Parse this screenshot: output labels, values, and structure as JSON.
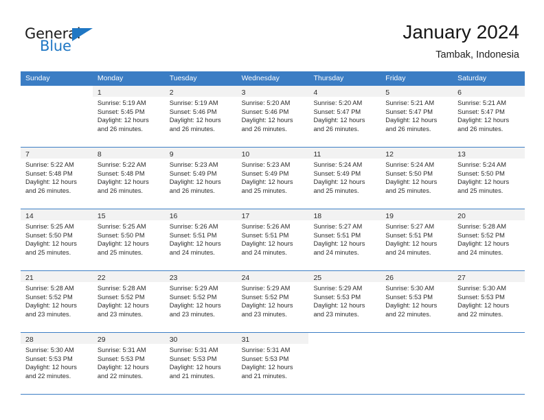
{
  "brand": {
    "name_top": "General",
    "name_bottom": "Blue",
    "accent_color": "#1f77c4"
  },
  "header": {
    "title": "January 2024",
    "subtitle": "Tambak, Indonesia"
  },
  "theme": {
    "header_band": "#3b7dc4",
    "daynum_band": "#f2f2f2",
    "rule": "#3b7dc4"
  },
  "weekdays": [
    "Sunday",
    "Monday",
    "Tuesday",
    "Wednesday",
    "Thursday",
    "Friday",
    "Saturday"
  ],
  "weeks": [
    {
      "lead_blanks": 1,
      "days": [
        {
          "num": "1",
          "sunrise": "Sunrise: 5:19 AM",
          "sunset": "Sunset: 5:45 PM",
          "daylight1": "Daylight: 12 hours",
          "daylight2": "and 26 minutes."
        },
        {
          "num": "2",
          "sunrise": "Sunrise: 5:19 AM",
          "sunset": "Sunset: 5:46 PM",
          "daylight1": "Daylight: 12 hours",
          "daylight2": "and 26 minutes."
        },
        {
          "num": "3",
          "sunrise": "Sunrise: 5:20 AM",
          "sunset": "Sunset: 5:46 PM",
          "daylight1": "Daylight: 12 hours",
          "daylight2": "and 26 minutes."
        },
        {
          "num": "4",
          "sunrise": "Sunrise: 5:20 AM",
          "sunset": "Sunset: 5:47 PM",
          "daylight1": "Daylight: 12 hours",
          "daylight2": "and 26 minutes."
        },
        {
          "num": "5",
          "sunrise": "Sunrise: 5:21 AM",
          "sunset": "Sunset: 5:47 PM",
          "daylight1": "Daylight: 12 hours",
          "daylight2": "and 26 minutes."
        },
        {
          "num": "6",
          "sunrise": "Sunrise: 5:21 AM",
          "sunset": "Sunset: 5:47 PM",
          "daylight1": "Daylight: 12 hours",
          "daylight2": "and 26 minutes."
        }
      ]
    },
    {
      "lead_blanks": 0,
      "days": [
        {
          "num": "7",
          "sunrise": "Sunrise: 5:22 AM",
          "sunset": "Sunset: 5:48 PM",
          "daylight1": "Daylight: 12 hours",
          "daylight2": "and 26 minutes."
        },
        {
          "num": "8",
          "sunrise": "Sunrise: 5:22 AM",
          "sunset": "Sunset: 5:48 PM",
          "daylight1": "Daylight: 12 hours",
          "daylight2": "and 26 minutes."
        },
        {
          "num": "9",
          "sunrise": "Sunrise: 5:23 AM",
          "sunset": "Sunset: 5:49 PM",
          "daylight1": "Daylight: 12 hours",
          "daylight2": "and 26 minutes."
        },
        {
          "num": "10",
          "sunrise": "Sunrise: 5:23 AM",
          "sunset": "Sunset: 5:49 PM",
          "daylight1": "Daylight: 12 hours",
          "daylight2": "and 25 minutes."
        },
        {
          "num": "11",
          "sunrise": "Sunrise: 5:24 AM",
          "sunset": "Sunset: 5:49 PM",
          "daylight1": "Daylight: 12 hours",
          "daylight2": "and 25 minutes."
        },
        {
          "num": "12",
          "sunrise": "Sunrise: 5:24 AM",
          "sunset": "Sunset: 5:50 PM",
          "daylight1": "Daylight: 12 hours",
          "daylight2": "and 25 minutes."
        },
        {
          "num": "13",
          "sunrise": "Sunrise: 5:24 AM",
          "sunset": "Sunset: 5:50 PM",
          "daylight1": "Daylight: 12 hours",
          "daylight2": "and 25 minutes."
        }
      ]
    },
    {
      "lead_blanks": 0,
      "days": [
        {
          "num": "14",
          "sunrise": "Sunrise: 5:25 AM",
          "sunset": "Sunset: 5:50 PM",
          "daylight1": "Daylight: 12 hours",
          "daylight2": "and 25 minutes."
        },
        {
          "num": "15",
          "sunrise": "Sunrise: 5:25 AM",
          "sunset": "Sunset: 5:50 PM",
          "daylight1": "Daylight: 12 hours",
          "daylight2": "and 25 minutes."
        },
        {
          "num": "16",
          "sunrise": "Sunrise: 5:26 AM",
          "sunset": "Sunset: 5:51 PM",
          "daylight1": "Daylight: 12 hours",
          "daylight2": "and 24 minutes."
        },
        {
          "num": "17",
          "sunrise": "Sunrise: 5:26 AM",
          "sunset": "Sunset: 5:51 PM",
          "daylight1": "Daylight: 12 hours",
          "daylight2": "and 24 minutes."
        },
        {
          "num": "18",
          "sunrise": "Sunrise: 5:27 AM",
          "sunset": "Sunset: 5:51 PM",
          "daylight1": "Daylight: 12 hours",
          "daylight2": "and 24 minutes."
        },
        {
          "num": "19",
          "sunrise": "Sunrise: 5:27 AM",
          "sunset": "Sunset: 5:51 PM",
          "daylight1": "Daylight: 12 hours",
          "daylight2": "and 24 minutes."
        },
        {
          "num": "20",
          "sunrise": "Sunrise: 5:28 AM",
          "sunset": "Sunset: 5:52 PM",
          "daylight1": "Daylight: 12 hours",
          "daylight2": "and 24 minutes."
        }
      ]
    },
    {
      "lead_blanks": 0,
      "days": [
        {
          "num": "21",
          "sunrise": "Sunrise: 5:28 AM",
          "sunset": "Sunset: 5:52 PM",
          "daylight1": "Daylight: 12 hours",
          "daylight2": "and 23 minutes."
        },
        {
          "num": "22",
          "sunrise": "Sunrise: 5:28 AM",
          "sunset": "Sunset: 5:52 PM",
          "daylight1": "Daylight: 12 hours",
          "daylight2": "and 23 minutes."
        },
        {
          "num": "23",
          "sunrise": "Sunrise: 5:29 AM",
          "sunset": "Sunset: 5:52 PM",
          "daylight1": "Daylight: 12 hours",
          "daylight2": "and 23 minutes."
        },
        {
          "num": "24",
          "sunrise": "Sunrise: 5:29 AM",
          "sunset": "Sunset: 5:52 PM",
          "daylight1": "Daylight: 12 hours",
          "daylight2": "and 23 minutes."
        },
        {
          "num": "25",
          "sunrise": "Sunrise: 5:29 AM",
          "sunset": "Sunset: 5:53 PM",
          "daylight1": "Daylight: 12 hours",
          "daylight2": "and 23 minutes."
        },
        {
          "num": "26",
          "sunrise": "Sunrise: 5:30 AM",
          "sunset": "Sunset: 5:53 PM",
          "daylight1": "Daylight: 12 hours",
          "daylight2": "and 22 minutes."
        },
        {
          "num": "27",
          "sunrise": "Sunrise: 5:30 AM",
          "sunset": "Sunset: 5:53 PM",
          "daylight1": "Daylight: 12 hours",
          "daylight2": "and 22 minutes."
        }
      ]
    },
    {
      "lead_blanks": 0,
      "days": [
        {
          "num": "28",
          "sunrise": "Sunrise: 5:30 AM",
          "sunset": "Sunset: 5:53 PM",
          "daylight1": "Daylight: 12 hours",
          "daylight2": "and 22 minutes."
        },
        {
          "num": "29",
          "sunrise": "Sunrise: 5:31 AM",
          "sunset": "Sunset: 5:53 PM",
          "daylight1": "Daylight: 12 hours",
          "daylight2": "and 22 minutes."
        },
        {
          "num": "30",
          "sunrise": "Sunrise: 5:31 AM",
          "sunset": "Sunset: 5:53 PM",
          "daylight1": "Daylight: 12 hours",
          "daylight2": "and 21 minutes."
        },
        {
          "num": "31",
          "sunrise": "Sunrise: 5:31 AM",
          "sunset": "Sunset: 5:53 PM",
          "daylight1": "Daylight: 12 hours",
          "daylight2": "and 21 minutes."
        }
      ]
    }
  ]
}
